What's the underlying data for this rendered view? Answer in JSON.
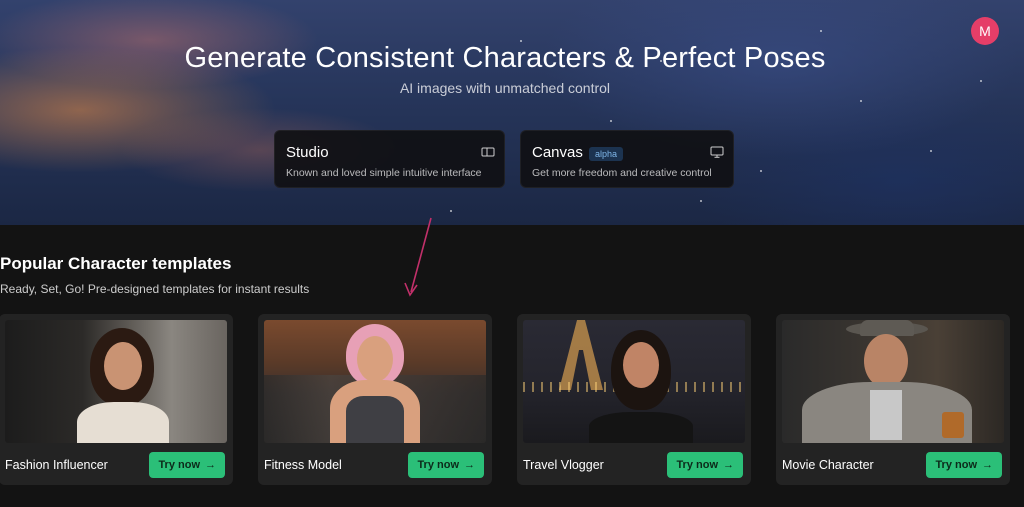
{
  "user": {
    "initial": "M"
  },
  "hero": {
    "title": "Generate Consistent Characters & Perfect Poses",
    "subtitle": "AI images with unmatched control"
  },
  "modes": [
    {
      "title": "Studio",
      "description": "Known and loved simple intuitive interface",
      "icon": "panel-icon"
    },
    {
      "title": "Canvas",
      "badge": "alpha",
      "description": "Get more freedom and creative control",
      "icon": "monitor-icon"
    }
  ],
  "templates_section": {
    "title": "Popular Character templates",
    "subtitle": "Ready, Set, Go! Pre-designed templates for instant results"
  },
  "templates": [
    {
      "name": "Fashion Influencer",
      "button": "Try now"
    },
    {
      "name": "Fitness Model",
      "button": "Try now"
    },
    {
      "name": "Travel Vlogger",
      "button": "Try now"
    },
    {
      "name": "Movie Character",
      "button": "Try now"
    }
  ],
  "colors": {
    "accent": "#2bbf78",
    "avatar": "#e53e68",
    "annotation_arrow": "#c2306a"
  }
}
